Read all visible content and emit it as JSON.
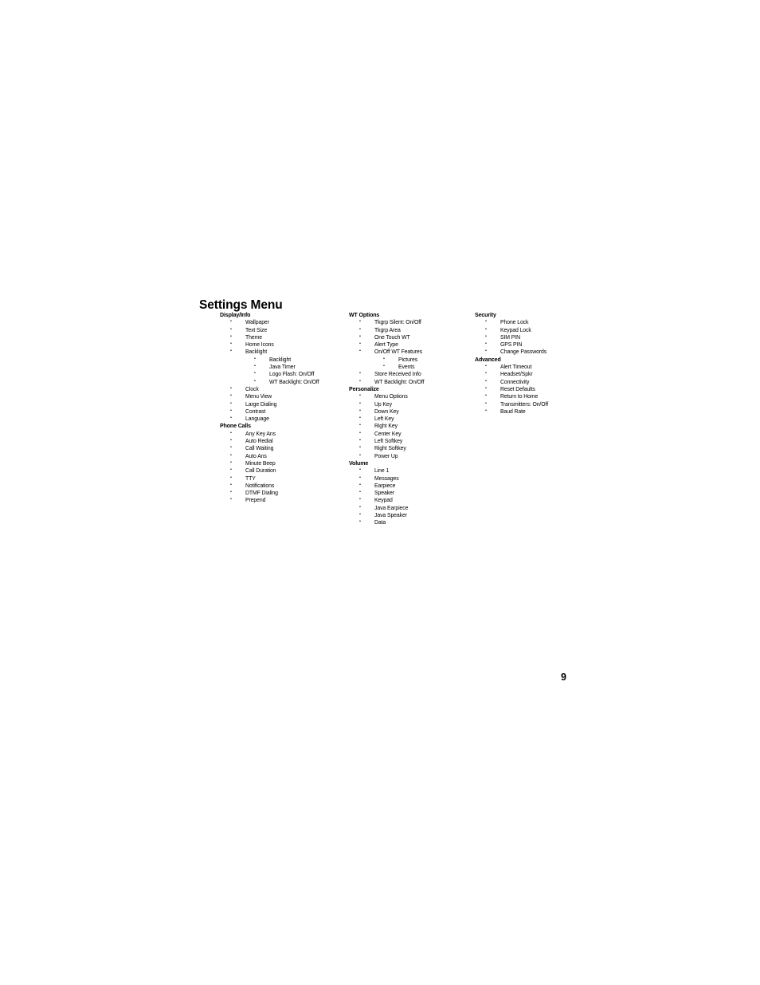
{
  "document": {
    "title": "Settings Menu",
    "page_number": "9"
  },
  "columns": [
    {
      "sections": [
        {
          "heading": "Display/Info",
          "items": [
            {
              "label": "Wallpaper"
            },
            {
              "label": "Text Size"
            },
            {
              "label": "Theme"
            },
            {
              "label": "Home Icons"
            },
            {
              "label": "Backlight",
              "children": [
                {
                  "label": "Backlight"
                },
                {
                  "label": "Java Timer"
                },
                {
                  "label": "Logo Flash: On/Off"
                },
                {
                  "label": "WT Backlight: On/Off"
                }
              ]
            },
            {
              "label": "Clock"
            },
            {
              "label": "Menu View"
            },
            {
              "label": "Large Dialing"
            },
            {
              "label": "Contrast"
            },
            {
              "label": "Language"
            }
          ]
        },
        {
          "heading": "Phone Calls",
          "items": [
            {
              "label": "Any Key Ans"
            },
            {
              "label": "Auto Redial"
            },
            {
              "label": "Call Waiting"
            },
            {
              "label": "Auto Ans"
            },
            {
              "label": "Minute Beep"
            },
            {
              "label": "Call Duration"
            },
            {
              "label": "TTY"
            },
            {
              "label": "Notifications"
            },
            {
              "label": "DTMF Dialing"
            },
            {
              "label": "Prepend"
            }
          ]
        }
      ]
    },
    {
      "sections": [
        {
          "heading": "WT Options",
          "items": [
            {
              "label": "Tkgrp Silent: On/Off"
            },
            {
              "label": "Tkgrp Area"
            },
            {
              "label": "One Touch WT"
            },
            {
              "label": "Alert Type"
            },
            {
              "label": "On/Off WT Features",
              "children": [
                {
                  "label": "Pictures"
                },
                {
                  "label": "Events"
                }
              ]
            },
            {
              "label": "Store Received Info"
            },
            {
              "label": "WT Backlight: On/Off"
            }
          ]
        },
        {
          "heading": "Personalize",
          "items": [
            {
              "label": "Menu Options"
            },
            {
              "label": "Up Key"
            },
            {
              "label": "Down Key"
            },
            {
              "label": "Left Key"
            },
            {
              "label": "Right Key"
            },
            {
              "label": "Center Key"
            },
            {
              "label": "Left Softkey"
            },
            {
              "label": "Right Softkey"
            },
            {
              "label": "Power Up"
            }
          ]
        },
        {
          "heading": "Volume",
          "items": [
            {
              "label": "Line 1"
            },
            {
              "label": "Messages"
            },
            {
              "label": "Earpiece"
            },
            {
              "label": "Speaker"
            },
            {
              "label": "Keypad"
            },
            {
              "label": "Java Earpiece"
            },
            {
              "label": "Java Speaker"
            },
            {
              "label": "Data"
            }
          ]
        }
      ]
    },
    {
      "sections": [
        {
          "heading": "Security",
          "items": [
            {
              "label": "Phone Lock"
            },
            {
              "label": "Keypad Lock"
            },
            {
              "label": "SIM PIN"
            },
            {
              "label": "GPS PIN"
            },
            {
              "label": "Change Passwords"
            }
          ]
        },
        {
          "heading": "Advanced",
          "items": [
            {
              "label": "Alert Timeout"
            },
            {
              "label": "Headset/Spkr"
            },
            {
              "label": "Connectivity"
            },
            {
              "label": "Reset Defaults"
            },
            {
              "label": "Return to Home"
            },
            {
              "label": "Transmitters: On/Off"
            },
            {
              "label": "Baud Rate"
            }
          ]
        }
      ]
    }
  ]
}
